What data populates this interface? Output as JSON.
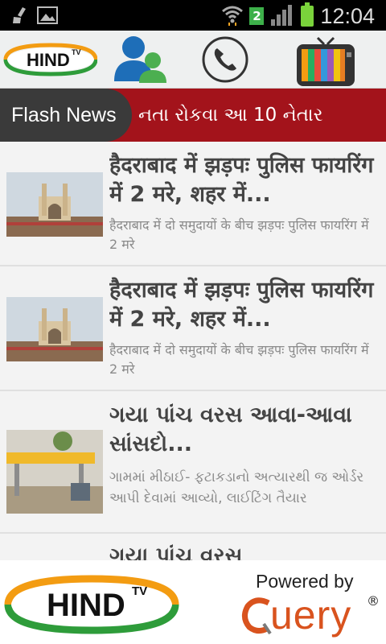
{
  "status_bar": {
    "time": "12:04",
    "sim_slot": "2",
    "icons": [
      "broom-icon",
      "image-icon",
      "wifi-icon",
      "signal-icon",
      "battery-icon"
    ]
  },
  "toolbar": {
    "logo_text": "HIND",
    "logo_sup": "TV",
    "icons": [
      "hindtv-logo",
      "users-icon",
      "phone-icon",
      "tv-icon"
    ]
  },
  "ticker": {
    "label": "Flash News",
    "text": "નતા રોકવા આ 10 નેતાર"
  },
  "news": [
    {
      "headline": "हैदराबाद में झड़पः पुलिस फायरिंग में 2 मरे, शहर में...",
      "summary": "हैदराबाद में दो समुदायों के बीच झड़पः पुलिस फायरिंग में 2 मरे"
    },
    {
      "headline": "हैदराबाद में झड़पः पुलिस फायरिंग में 2 मरे, शहर में...",
      "summary": "हैदराबाद में दो समुदायों के बीच झड़पः पुलिस फायरिंग में 2 मरे"
    },
    {
      "headline": "ગયા પાંચ વરસ આવા-આવા સાંસદો...",
      "summary": "ગામમાં મીઠાઈ- ફટાકડાનો અત્યારથી જ ઓર્ડર આપી દેવામાં આવ્યો, લાઈટિંગ તૈયાર"
    },
    {
      "headline": "ગયા પાંચ વરસ",
      "summary": ""
    }
  ],
  "footer": {
    "logo_text": "HIND",
    "logo_sup": "TV",
    "powered_by": "Powered by",
    "query_text": "uery",
    "reg": "®"
  }
}
